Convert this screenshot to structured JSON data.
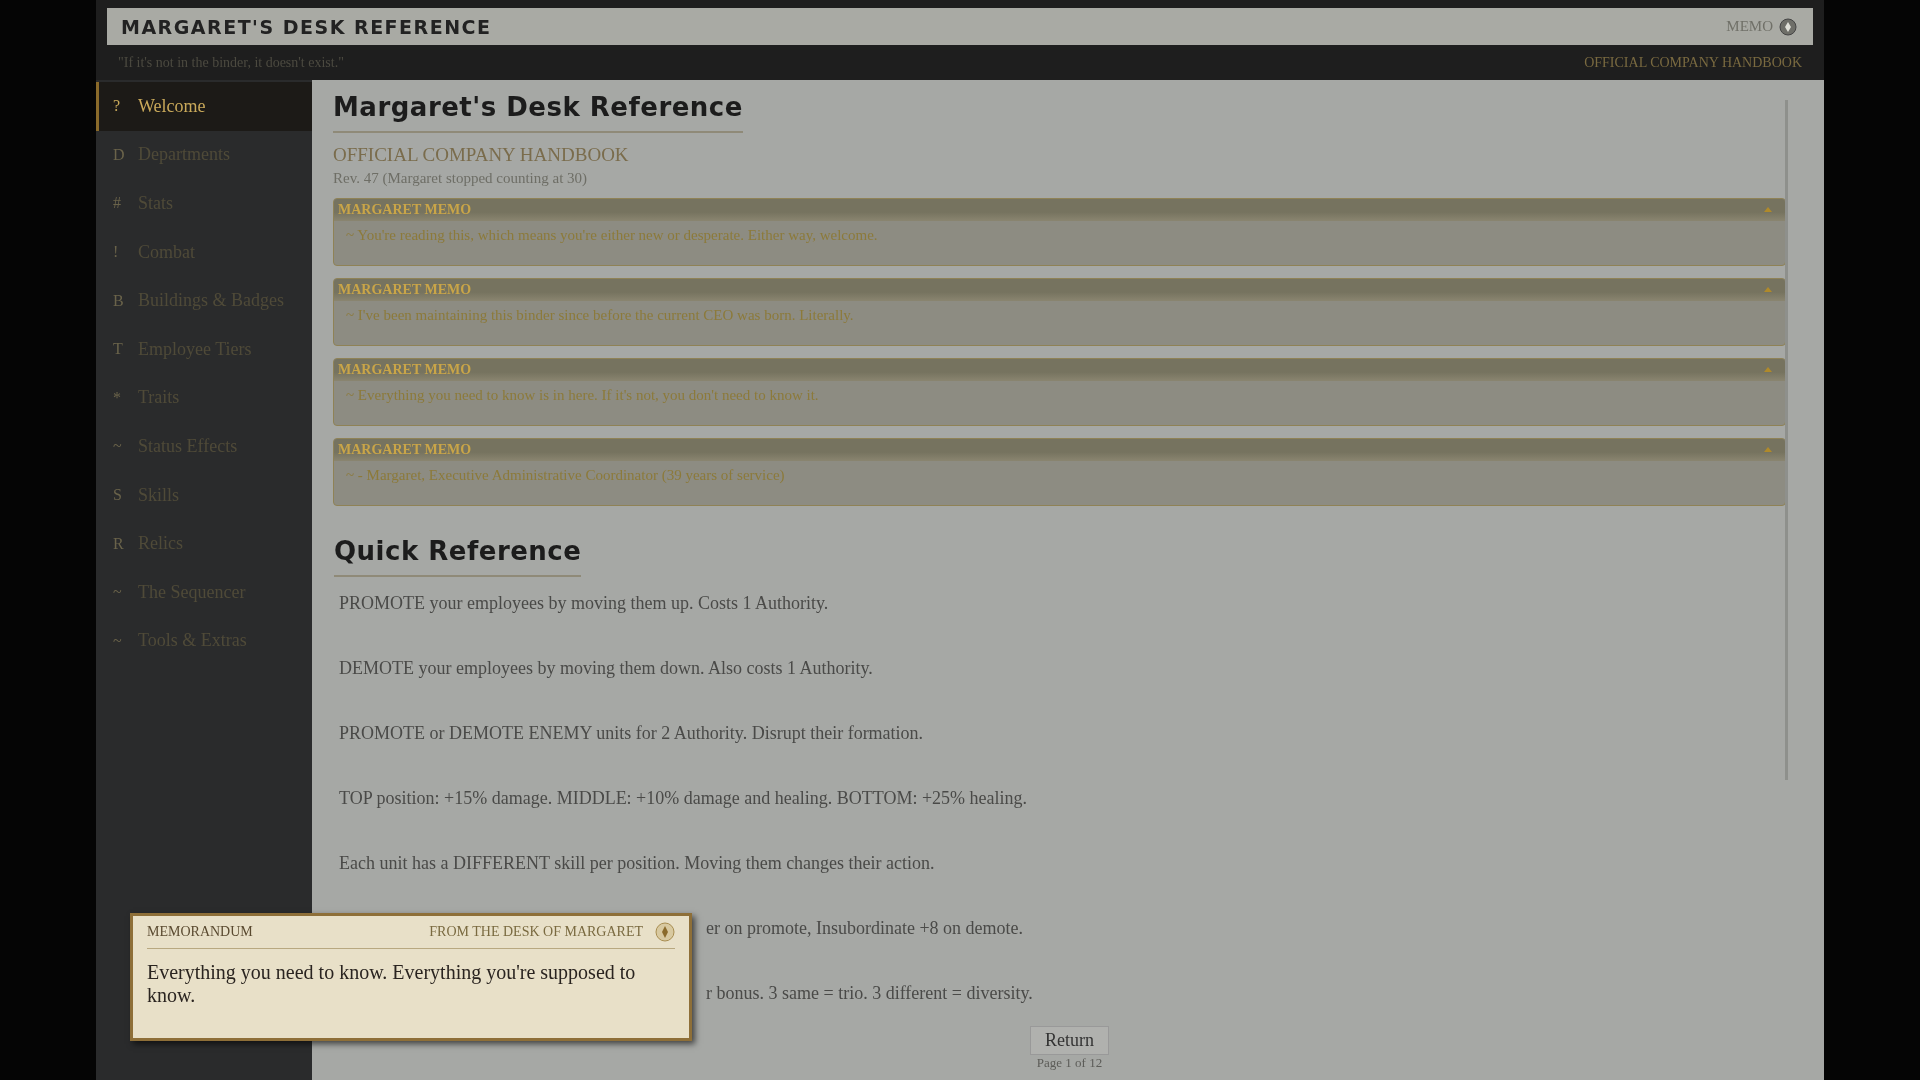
{
  "header": {
    "title": "MARGARET'S DESK REFERENCE",
    "memo_label": "MEMO",
    "tagline": "\"If it's not in the binder, it doesn't exist.\"",
    "handbook_label": "OFFICIAL COMPANY HANDBOOK"
  },
  "sidebar": {
    "items": [
      {
        "glyph": "?",
        "label": "Welcome",
        "selected": true
      },
      {
        "glyph": "D",
        "label": "Departments",
        "selected": false
      },
      {
        "glyph": "#",
        "label": "Stats",
        "selected": false
      },
      {
        "glyph": "!",
        "label": "Combat",
        "selected": false
      },
      {
        "glyph": "B",
        "label": "Buildings & Badges",
        "selected": false
      },
      {
        "glyph": "T",
        "label": "Employee Tiers",
        "selected": false
      },
      {
        "glyph": "*",
        "label": "Traits",
        "selected": false
      },
      {
        "glyph": "~",
        "label": "Status Effects",
        "selected": false
      },
      {
        "glyph": "S",
        "label": "Skills",
        "selected": false
      },
      {
        "glyph": "R",
        "label": "Relics",
        "selected": false
      },
      {
        "glyph": "~",
        "label": "The Sequencer",
        "selected": false
      },
      {
        "glyph": "~",
        "label": "Tools & Extras",
        "selected": false
      }
    ]
  },
  "page": {
    "title": "Margaret's Desk Reference",
    "subtitle": "OFFICIAL COMPANY HANDBOOK",
    "revision": "Rev. 47 (Margaret stopped counting at 30)",
    "memos": [
      {
        "title": "MARGARET MEMO",
        "body": "~ You're reading this, which means you're either new or desperate. Either way, welcome.",
        "expanded": true
      },
      {
        "title": "MARGARET MEMO",
        "body": "~ I've been maintaining this binder since before the current CEO was born. Literally.",
        "expanded": true
      },
      {
        "title": "MARGARET MEMO",
        "body": "~ Everything you need to know is in here. If it's not, you don't need to know it.",
        "expanded": true
      },
      {
        "title": "MARGARET MEMO",
        "body": "~ - Margaret, Executive Administrative Coordinator (39 years of service)",
        "expanded": true
      }
    ],
    "section_title": "Quick Reference",
    "lines": [
      "PROMOTE your employees by moving them up. Costs 1 Authority.",
      "DEMOTE your employees by moving them down. Also costs 1 Authority.",
      "PROMOTE or DEMOTE ENEMY units for 2 Authority. Disrupt their formation.",
      "TOP position: +15% damage. MIDDLE: +10% damage and healing. BOTTOM: +25% healing.",
      "Each unit has a DIFFERENT skill per position. Moving them changes their action."
    ],
    "hidden_line_ends": [
      "er on promote, Insubordinate +8 on demote.",
      "r bonus. 3 same = trio. 3 different = diversity."
    ],
    "return_button": "Return",
    "page_indicator": "Page 1 of 12"
  },
  "memorandum": {
    "label": "MEMORANDUM",
    "from": "FROM THE DESK OF MARGARET",
    "body": "Everything you need to know. Everything you're supposed to know."
  }
}
